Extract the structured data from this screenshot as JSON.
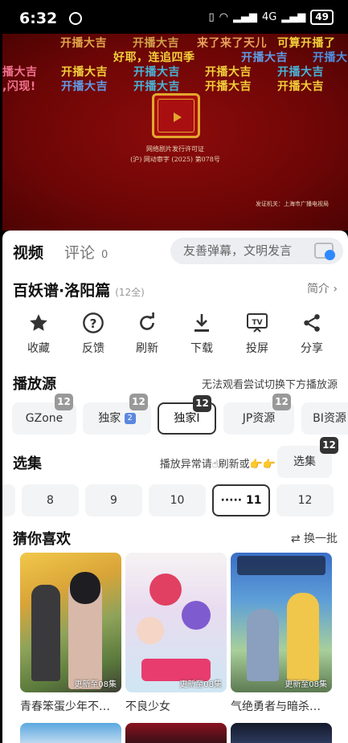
{
  "status_bar": {
    "time": "6:32",
    "battery": "49",
    "network": "4G"
  },
  "video": {
    "danmaku": [
      {
        "text": "开播大吉",
        "color": "#e3a54a"
      },
      {
        "text": "开播大吉",
        "color": "#d2a14a"
      },
      {
        "text": "来了来了天儿",
        "color": "#e8a15c"
      },
      {
        "text": "可算开播了",
        "color": "#f2d03b"
      },
      {
        "text": "好耶，连追四季",
        "color": "#f2d03b"
      },
      {
        "text": "开播大吉",
        "color": "#5f9de8"
      },
      {
        "text": "开播大吉",
        "color": "#4f8fe0"
      },
      {
        "text": "播大吉",
        "color": "#f0728f"
      },
      {
        "text": "开播大吉",
        "color": "#f2d03b"
      },
      {
        "text": "开播大吉",
        "color": "#48b4d8"
      },
      {
        "text": "开播大吉",
        "color": "#f2d03b"
      },
      {
        "text": "开播大吉",
        "color": "#48b4d8"
      },
      {
        "text": ",闪现!",
        "color": "#f0728f"
      },
      {
        "text": "开播大吉",
        "color": "#5f9de8"
      },
      {
        "text": "开播大吉",
        "color": "#48b4d8"
      },
      {
        "text": "开播大吉",
        "color": "#f2d03b"
      },
      {
        "text": "开播大吉",
        "color": "#f2d03b"
      }
    ],
    "license_title": "网络剧片发行许可证",
    "license_number": "(沪) 网动审字 (2025) 第078号",
    "issuer": "发证机关：上海市广播电视局"
  },
  "tabs": {
    "video": "视频",
    "comment": "评论",
    "comment_count": "0"
  },
  "danmaku_input": {
    "placeholder": "友善弹幕，文明发言"
  },
  "show": {
    "title": "百妖谱·洛阳篇",
    "episodes": "(12全)",
    "intro": "简介 ›"
  },
  "actions": [
    {
      "label": "收藏",
      "icon": "star-icon"
    },
    {
      "label": "反馈",
      "icon": "question-icon"
    },
    {
      "label": "刷新",
      "icon": "refresh-icon"
    },
    {
      "label": "下载",
      "icon": "download-icon"
    },
    {
      "label": "投屏",
      "icon": "cast-tv-icon"
    },
    {
      "label": "分享",
      "icon": "share-icon"
    }
  ],
  "sources": {
    "heading": "播放源",
    "note": "无法观看尝试切换下方播放源",
    "items": [
      {
        "label": "GZone",
        "badge": "12"
      },
      {
        "label": "独家",
        "badge": "12",
        "mini": "2"
      },
      {
        "label": "独家I",
        "badge": "12"
      },
      {
        "label": "JP资源",
        "badge": "12"
      },
      {
        "label": "BI资源"
      }
    ]
  },
  "episodes": {
    "heading": "选集",
    "note": "播放异常请☝刷新或👉👉",
    "button": "选集",
    "button_badge": "12",
    "items": [
      "8",
      "9",
      "10",
      "····· 11",
      "12"
    ]
  },
  "recommend": {
    "heading": "猜你喜欢",
    "refresh": "换一批",
    "cards": [
      {
        "title": "青春笨蛋少年不…",
        "update": "更新至08集"
      },
      {
        "title": "不良少女",
        "update": "更新至08集"
      },
      {
        "title": "气绝勇者与暗杀…",
        "update": "更新至08集"
      }
    ]
  },
  "colors": {
    "accent_blue": "#2e89ff",
    "video_bg": "#7a0707"
  }
}
